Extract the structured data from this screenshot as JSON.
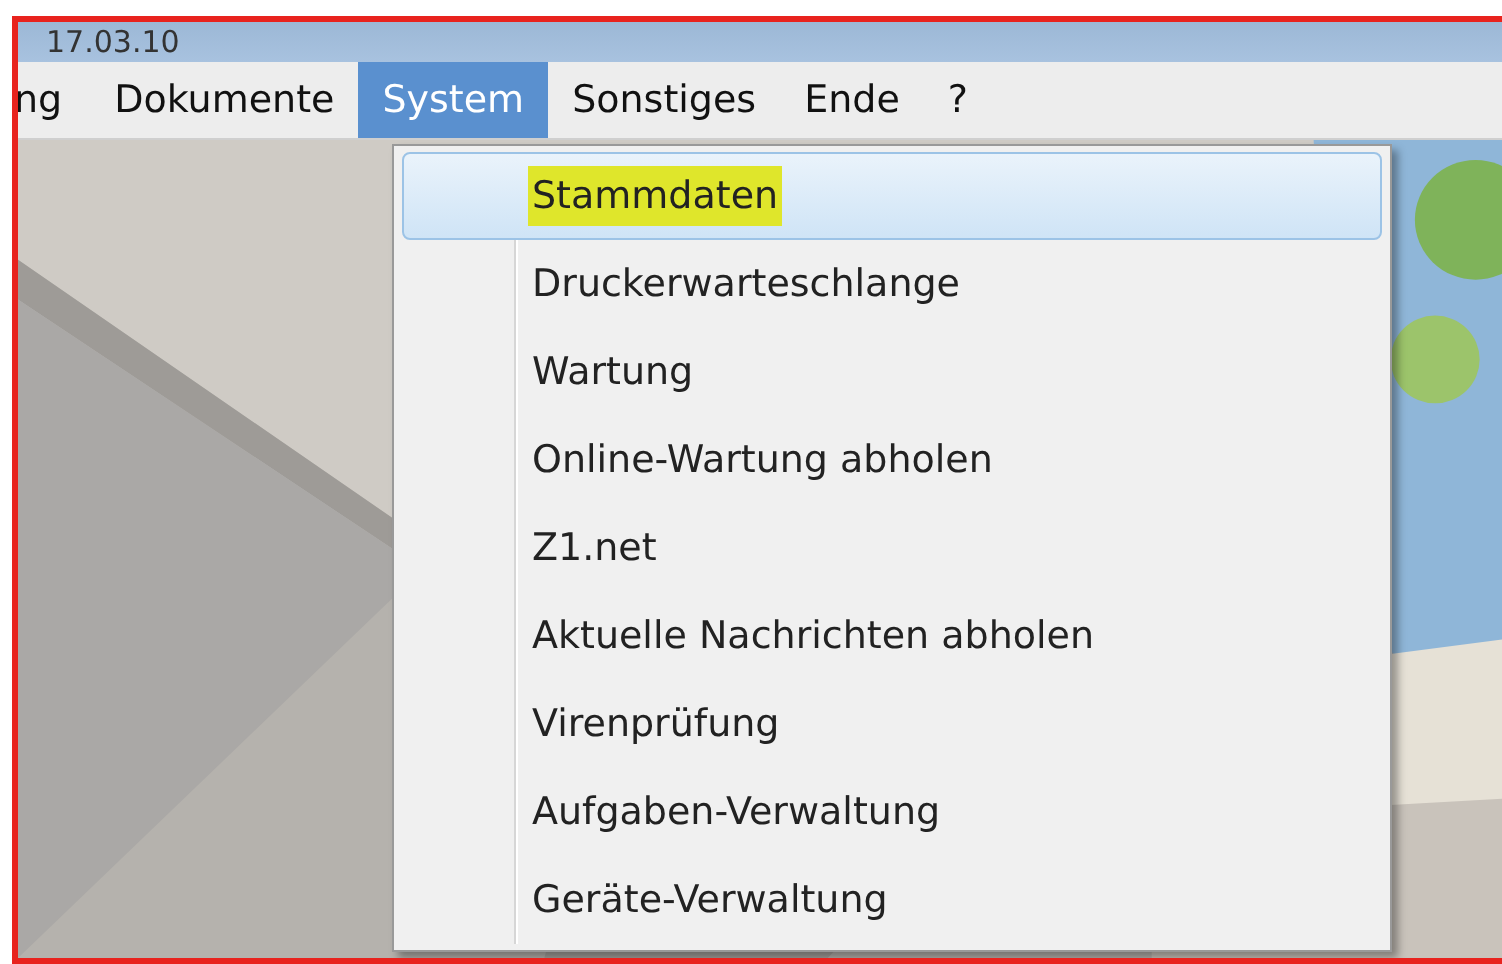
{
  "window": {
    "title": "17.03.10"
  },
  "menu_bar": [
    {
      "label": "ng",
      "selected": false
    },
    {
      "label": "Dokumente",
      "selected": false
    },
    {
      "label": "System",
      "selected": true
    },
    {
      "label": "Sonstiges",
      "selected": false
    },
    {
      "label": "Ende",
      "selected": false
    },
    {
      "label": "?",
      "selected": false
    }
  ],
  "dropdown": [
    {
      "label": "Stammdaten",
      "selected": true,
      "marked": true
    },
    {
      "label": "Druckerwarteschlange",
      "selected": false,
      "marked": false
    },
    {
      "label": "Wartung",
      "selected": false,
      "marked": false
    },
    {
      "label": "Online-Wartung abholen",
      "selected": false,
      "marked": false
    },
    {
      "label": "Z1.net",
      "selected": false,
      "marked": false
    },
    {
      "label": "Aktuelle Nachrichten abholen",
      "selected": false,
      "marked": false
    },
    {
      "label": "Virenprüfung",
      "selected": false,
      "marked": false
    },
    {
      "label": "Aufgaben-Verwaltung",
      "selected": false,
      "marked": false
    },
    {
      "label": "Geräte-Verwaltung",
      "selected": false,
      "marked": false
    }
  ]
}
